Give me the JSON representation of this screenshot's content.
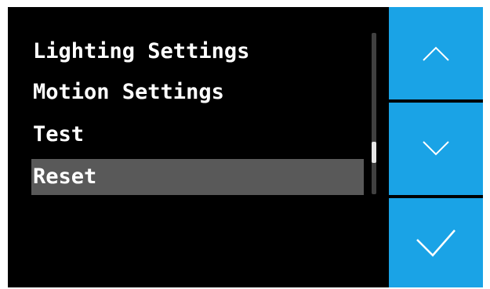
{
  "menu": {
    "items": [
      {
        "label": "Lighting Settings",
        "selected": false
      },
      {
        "label": "Motion Settings",
        "selected": false
      },
      {
        "label": "Test",
        "selected": false
      },
      {
        "label": "Reset",
        "selected": true
      }
    ]
  },
  "buttons": {
    "up": {
      "icon": "chevron-up-icon"
    },
    "down": {
      "icon": "chevron-down-icon"
    },
    "confirm": {
      "icon": "check-icon"
    }
  },
  "colors": {
    "screen_background": "#000000",
    "menu_text": "#ffffff",
    "selected_highlight": "#595959",
    "button_background": "#1aa3e6",
    "icon_stroke": "#ffffff",
    "scrollbar_track": "#404040",
    "scrollbar_thumb": "#e6e6e6"
  }
}
